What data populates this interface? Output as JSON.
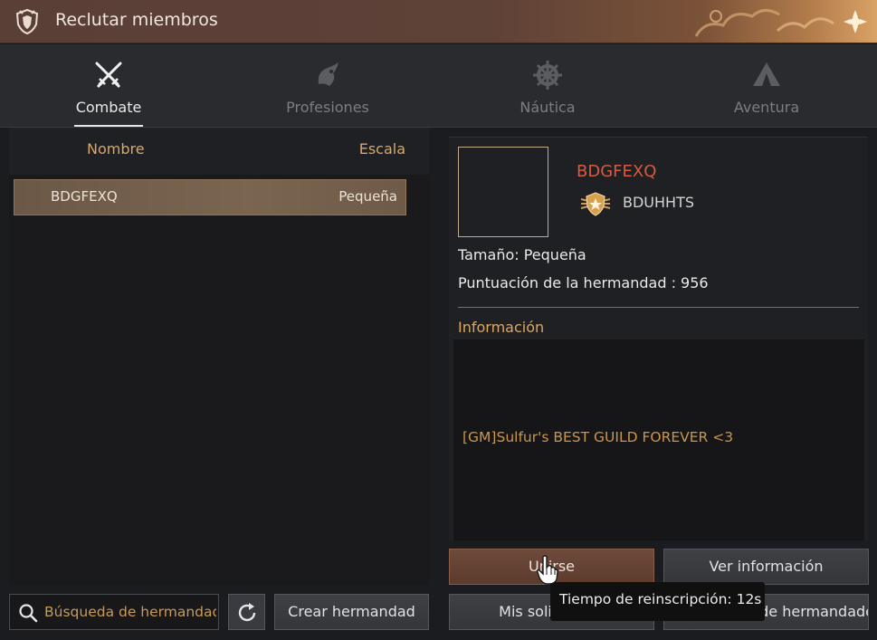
{
  "window": {
    "title": "Reclutar miembros",
    "title_icon": "guild-crest-icon"
  },
  "tabs": [
    {
      "label": "Combate",
      "icon": "crossed-swords-icon",
      "active": true
    },
    {
      "label": "Profesiones",
      "icon": "fish-icon",
      "active": false
    },
    {
      "label": "Náutica",
      "icon": "ship-wheel-icon",
      "active": false
    },
    {
      "label": "Aventura",
      "icon": "tent-icon",
      "active": false
    }
  ],
  "list": {
    "col_name": "Nombre",
    "col_scale": "Escala",
    "rows": [
      {
        "name": "BDGFEXQ",
        "scale": "Pequeña",
        "selected": true
      }
    ]
  },
  "search": {
    "placeholder": "Búsqueda de hermandad"
  },
  "buttons": {
    "create": "Crear hermandad",
    "join": "Unirse",
    "view_info": "Ver información",
    "my_applications": "Mis solicitudes",
    "ranking": "Clasificación de hermandades"
  },
  "guild": {
    "name": "BDGFEXQ",
    "master": "BDUHHTS",
    "size": "Tamaño: Pequeña",
    "score": "Puntuación de la hermandad : 956",
    "info_label": "Información",
    "info_text": "[GM]Sulfur's BEST GUILD FOREVER <3"
  },
  "tooltip": {
    "text": "Tiempo de reinscripción: 12s"
  },
  "colors": {
    "accent_gold": "#d9a866",
    "guild_name_red": "#d95a3c",
    "selected_row": "#7a6550",
    "join_button": "#6e4a3a"
  }
}
